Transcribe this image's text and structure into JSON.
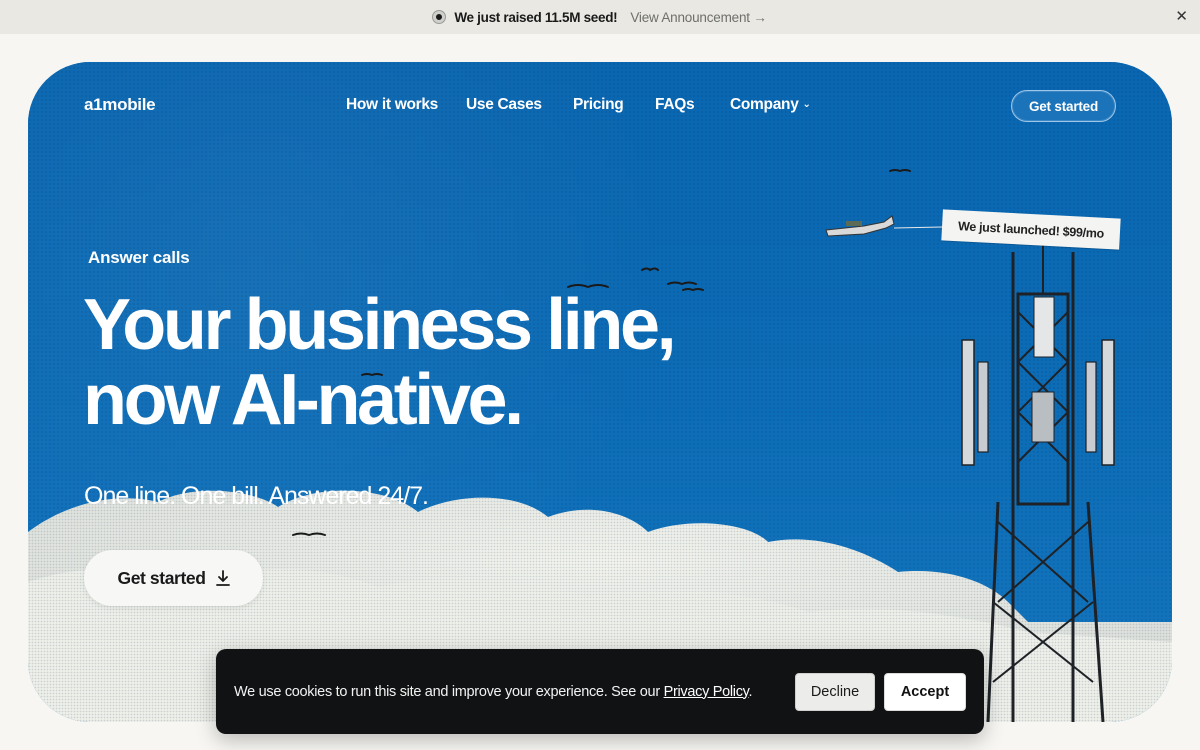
{
  "announcement": {
    "message": "We just raised 11.5M seed!",
    "link_label": "View Announcement →",
    "close_glyph": "✕"
  },
  "nav": {
    "logo": "a1mobile",
    "links": [
      "How it works",
      "Use Cases",
      "Pricing",
      "FAQs",
      "Company"
    ],
    "cta_label": "Get started"
  },
  "hero": {
    "eyebrow": "Answer calls",
    "headline_line1": "Your business line,",
    "headline_line2": "now AI-native.",
    "subline": "One line. One bill. Answered 24/7.",
    "cta_label": "Get started",
    "banner_text": "We just launched! $99/mo"
  },
  "cookie": {
    "text": "We use cookies to run this site and improve your experience. See our ",
    "policy_link": "Privacy Policy",
    "period": ".",
    "decline_label": "Decline",
    "accept_label": "Accept"
  },
  "colors": {
    "page_bg": "#f7f6f2",
    "hero_blue": "#0c6ab3",
    "cookie_bg": "#111214"
  }
}
